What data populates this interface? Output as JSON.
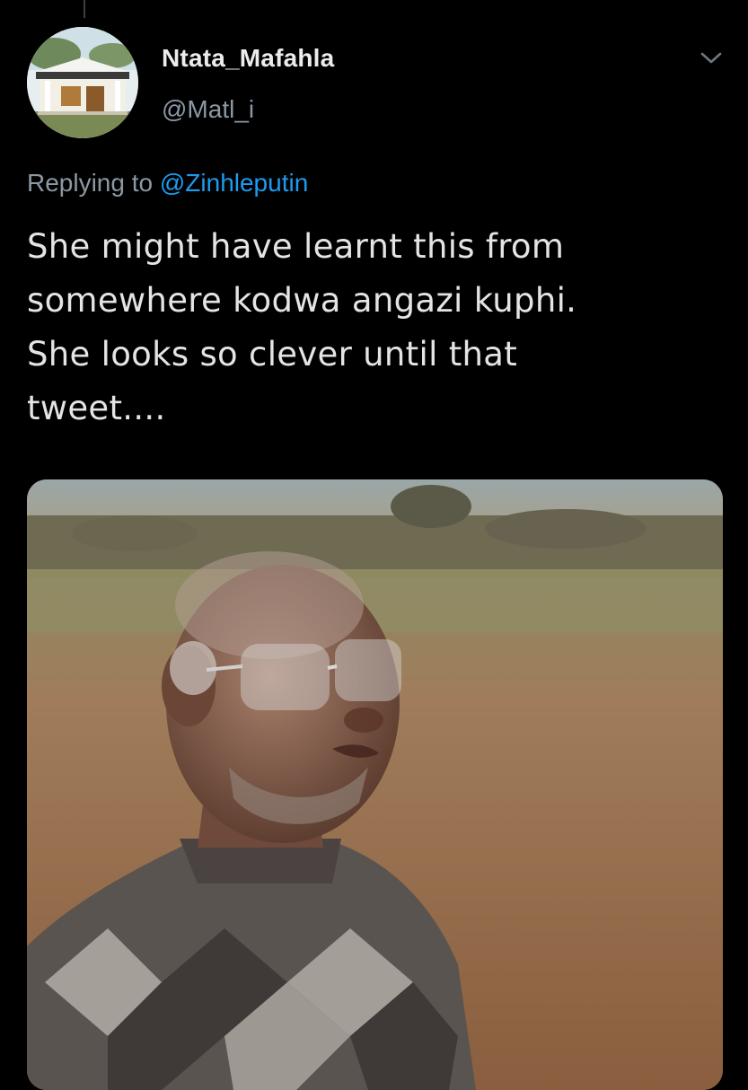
{
  "tweet": {
    "author": {
      "display_name": "Ntata_Mafahla",
      "handle": "@Matl_i",
      "avatar": "house-photo"
    },
    "reply": {
      "prefix": "Replying to",
      "mention": "@Zinhleputin"
    },
    "text_lines": [
      "She might have learnt this from",
      "somewhere kodwa angazi kuphi.",
      "She looks so clever until that",
      "tweet...."
    ],
    "more_icon": "chevron-down-icon",
    "media": {
      "kind": "photo"
    }
  },
  "colors": {
    "background": "#000000",
    "primary_text": "#e4e4e4",
    "secondary_text": "#8b98a5",
    "link": "#1d9bf0"
  }
}
